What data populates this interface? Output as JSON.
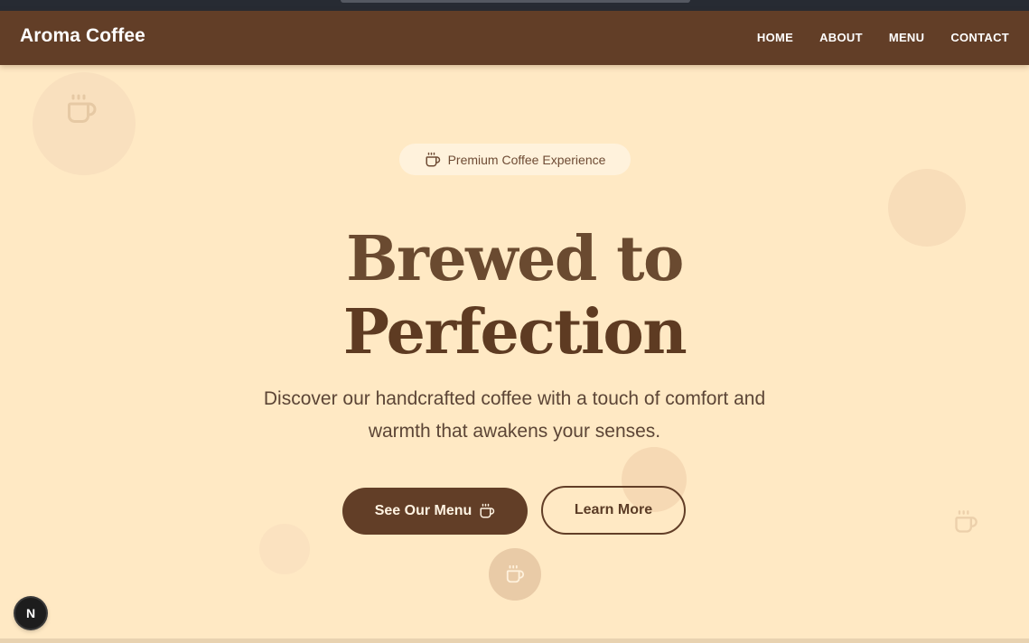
{
  "navbar": {
    "brand": "Aroma Coffee",
    "links": [
      "HOME",
      "ABOUT",
      "MENU",
      "CONTACT"
    ]
  },
  "hero": {
    "badge": "Premium Coffee Experience",
    "title_line1": "Brewed to",
    "title_line2": "Perfection",
    "subtitle_line1": "Discover our handcrafted coffee with a touch of comfort and",
    "subtitle_line2": "warmth that awakens your senses.",
    "primary_button": "See Our Menu",
    "secondary_button": "Learn More"
  },
  "dev_indicator": {
    "label": "N"
  },
  "colors": {
    "background": "#ffe9c4",
    "navbar": "#623e27",
    "accent_dark": "#5e3b22",
    "text": "#5c4536"
  },
  "icons": [
    "coffee-cup-icon"
  ]
}
